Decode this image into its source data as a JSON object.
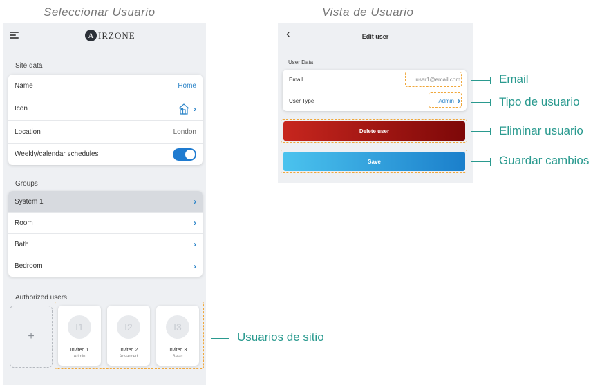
{
  "captions": {
    "left": "Seleccionar Usuario",
    "right": "Vista de Usuario"
  },
  "left_screen": {
    "logo_text": "IRZONE",
    "logo_mark": "A",
    "site_data": {
      "heading": "Site data",
      "rows": [
        {
          "label": "Name",
          "value": "Home"
        },
        {
          "label": "Icon",
          "icon": "house-icon"
        },
        {
          "label": "Location",
          "value": "London"
        },
        {
          "label": "Weekly/calendar schedules",
          "toggle": true
        }
      ]
    },
    "groups": {
      "heading": "Groups",
      "rows": [
        {
          "label": "System 1",
          "selected": true
        },
        {
          "label": "Room"
        },
        {
          "label": "Bath"
        },
        {
          "label": "Bedroom"
        }
      ]
    },
    "authorized_users": {
      "heading": "Authorized users",
      "add_symbol": "+",
      "users": [
        {
          "initials": "I1",
          "name": "Invited 1",
          "role": "Admin"
        },
        {
          "initials": "I2",
          "name": "Invited 2",
          "role": "Advanced"
        },
        {
          "initials": "I3",
          "name": "Invited 3",
          "role": "Basic"
        }
      ]
    }
  },
  "right_screen": {
    "title": "Edit user",
    "back_symbol": "‹",
    "user_data_heading": "User Data",
    "email_label": "Email",
    "email_value": "user1@email.com",
    "type_label": "User Type",
    "type_value": "Admin",
    "delete_label": "Delete user",
    "save_label": "Save"
  },
  "annotations": {
    "email": "Email",
    "type": "Tipo de usuario",
    "delete": "Eliminar usuario",
    "save": "Guardar cambios",
    "users": "Usuarios de sitio"
  },
  "colors": {
    "accent": "#2f86c9",
    "annotation": "#2a9a8f",
    "highlight": "#f0a73a",
    "delete": "#b21a15",
    "save": "#2aa2e0"
  }
}
